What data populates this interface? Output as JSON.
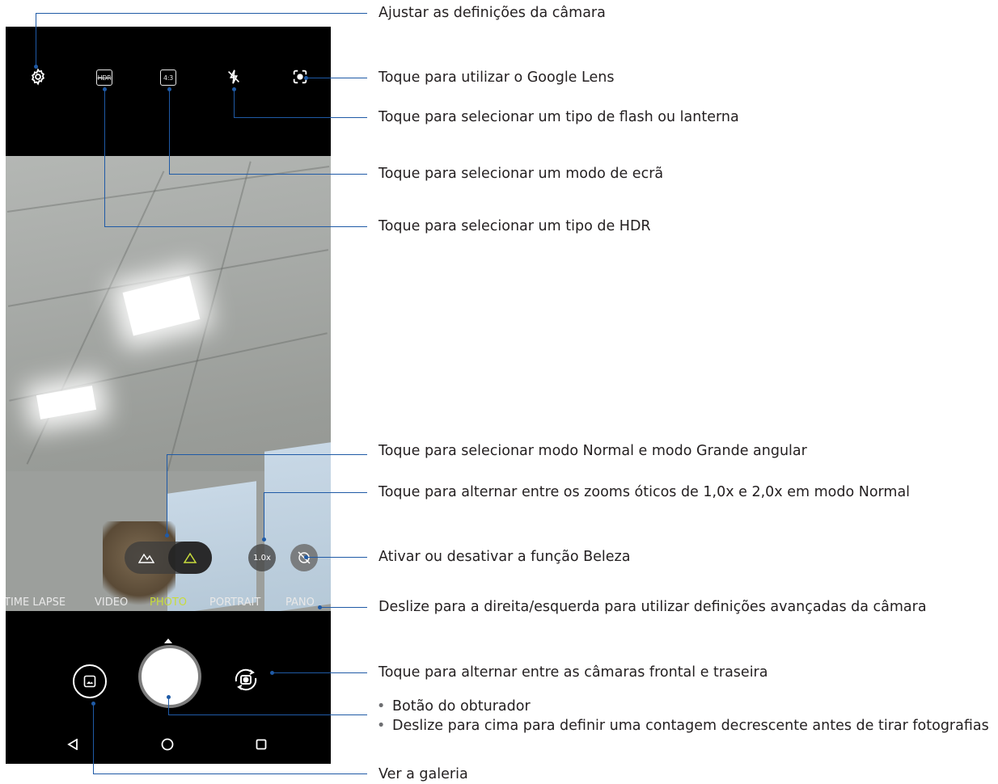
{
  "camera": {
    "top_bar_icons": [
      "gear-icon",
      "hdr-off-icon",
      "aspect-ratio-icon",
      "flash-off-icon",
      "google-lens-icon"
    ],
    "hdr_icon_text": "HDR",
    "aspect_ratio_text": "4:3",
    "zoom_label": "1.0x",
    "modes": [
      "TIME LAPSE",
      "VIDEO",
      "PHOTO",
      "PORTRAIT",
      "PANO"
    ],
    "active_mode": "PHOTO",
    "accent_color": "#c8dc3c",
    "nav_icons": [
      "back-icon",
      "home-icon",
      "recents-icon"
    ]
  },
  "annotations": {
    "settings": "Ajustar as definições da câmara",
    "google_lens": "Toque para utilizar o Google Lens",
    "flash": "Toque para selecionar um tipo de flash ou lanterna",
    "screen_mode": "Toque para selecionar um modo de ecrã",
    "hdr": "Toque para selecionar um tipo de HDR",
    "wide_angle": "Toque para selecionar modo Normal e modo Grande angular",
    "optical_zoom": "Toque para alternar entre os zooms óticos de 1,0x e 2,0x em modo Normal",
    "beauty": "Ativar ou desativar a função Beleza",
    "swipe_modes": "Deslize para a direita/esquerda para utilizar definições avançadas da câmara",
    "switch_camera": "Toque para alternar entre as câmaras frontal e traseira",
    "shutter_bullets": [
      "Botão do obturador",
      "Deslize para cima para definir uma contagem decrescente antes de tirar fotografias"
    ],
    "gallery": "Ver a galeria"
  },
  "leader_color": "#1f5aa6"
}
